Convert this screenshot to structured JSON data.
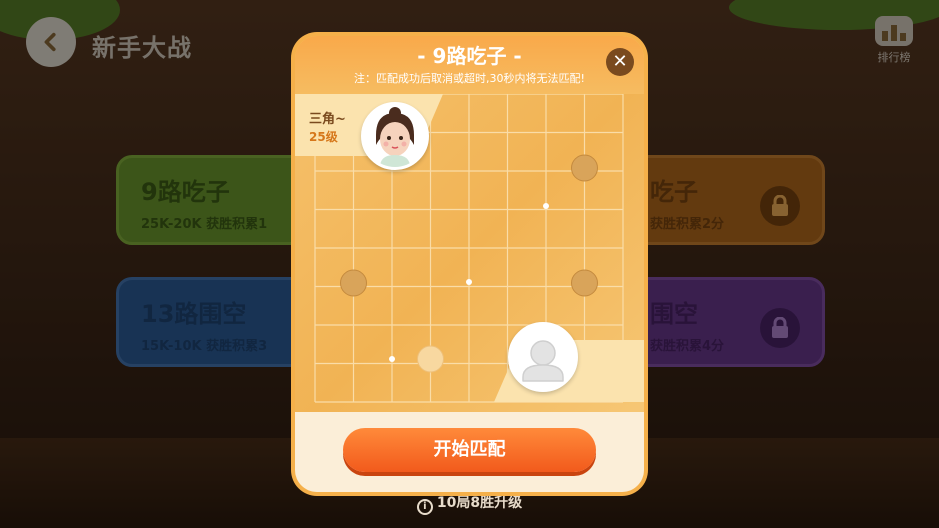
{
  "header": {
    "title": "新手大战",
    "rank_label": "排行榜"
  },
  "modes": [
    {
      "title": "9路吃子",
      "sub": "25K-20K  获胜积累1"
    },
    {
      "title": "13路围空",
      "sub": "15K-10K  获胜积累3"
    },
    {
      "title": "吃子",
      "sub": "获胜积累2分"
    },
    {
      "title": "围空",
      "sub": "获胜积累4分"
    }
  ],
  "modal": {
    "title": "- 9路吃子 -",
    "note": "注：匹配成功后取消或超时,30秒内将无法匹配!",
    "player1": {
      "name": "三角~",
      "level": "25级"
    },
    "start_label": "开始匹配"
  },
  "footer": {
    "note": "10局8胜升级"
  },
  "colors": {
    "accent": "#f25a1c",
    "board": "#f1b354",
    "header": "#f9a94a"
  },
  "icons": [
    "back-arrow-icon",
    "rank-icon",
    "lock-icon",
    "close-icon",
    "info-icon",
    "avatar-icon"
  ]
}
